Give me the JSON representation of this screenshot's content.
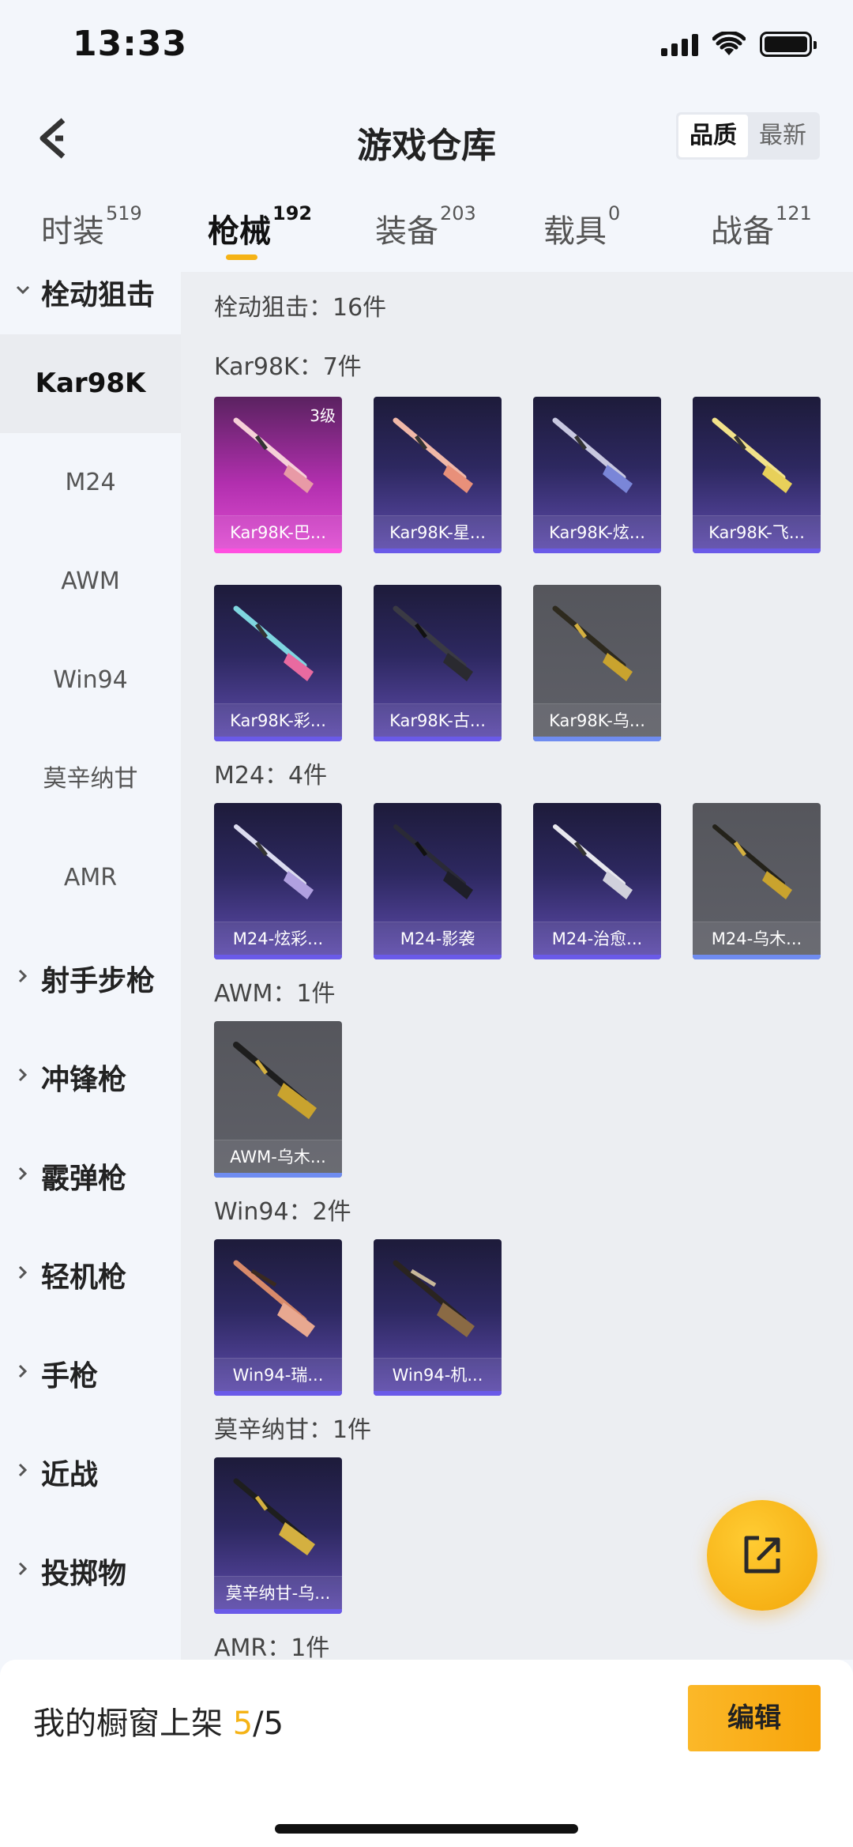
{
  "status": {
    "time": "13:33"
  },
  "header": {
    "title": "游戏仓库",
    "sort_options": [
      "品质",
      "最新"
    ],
    "sort_active": "品质"
  },
  "tabs": [
    {
      "label": "时装",
      "count": "519"
    },
    {
      "label": "枪械",
      "count": "192"
    },
    {
      "label": "装备",
      "count": "203"
    },
    {
      "label": "载具",
      "count": "0"
    },
    {
      "label": "战备",
      "count": "121"
    }
  ],
  "sidebar": {
    "group_bolt": "栓动狙击",
    "items": [
      "Kar98K",
      "M24",
      "AWM",
      "Win94",
      "莫辛纳甘",
      "AMR"
    ],
    "groups": [
      "射手步枪",
      "冲锋枪",
      "霰弹枪",
      "轻机枪",
      "手枪",
      "近战",
      "投掷物"
    ]
  },
  "content": {
    "category_total": "栓动狙击：16件",
    "sections": {
      "kar": {
        "label": "Kar98K：7件",
        "items": [
          "Kar98K-巴...",
          "Kar98K-星...",
          "Kar98K-炫...",
          "Kar98K-飞...",
          "Kar98K-彩...",
          "Kar98K-古...",
          "Kar98K-乌..."
        ],
        "level_badge": "3级"
      },
      "m24": {
        "label": "M24：4件",
        "items": [
          "M24-炫彩...",
          "M24-影袭",
          "M24-治愈...",
          "M24-乌木..."
        ]
      },
      "awm": {
        "label": "AWM：1件",
        "items": [
          "AWM-乌木..."
        ]
      },
      "win94": {
        "label": "Win94：2件",
        "items": [
          "Win94-瑞...",
          "Win94-机..."
        ]
      },
      "mosin": {
        "label": "莫辛纳甘：1件",
        "items": [
          "莫辛纳甘-乌..."
        ]
      },
      "amr": {
        "label": "AMR：1件"
      }
    }
  },
  "bottom": {
    "showcase_label": "我的橱窗上架",
    "showcase_current": "5",
    "showcase_sep": "/",
    "showcase_max": "5",
    "edit_label": "编辑"
  },
  "colors": {
    "accent": "#f5b316",
    "purple_card": "#2d2860",
    "gray_card": "#5a5b61",
    "legendary_card": "#b12fae"
  },
  "icons": [
    "back-arrow-icon",
    "share-icon",
    "chevron-down-icon",
    "chevron-right-icon",
    "rifle-icon"
  ]
}
